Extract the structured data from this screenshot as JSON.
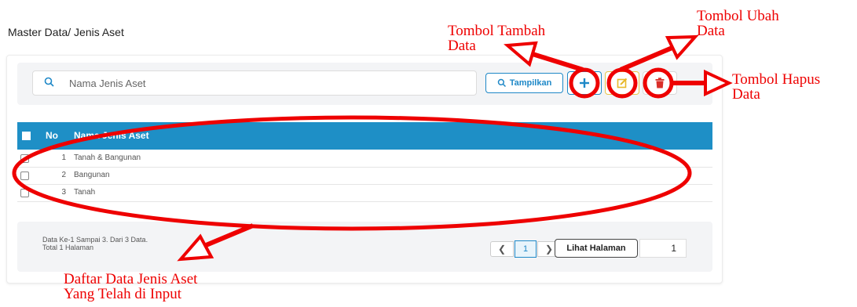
{
  "page": {
    "title": "Master Data/ Jenis Aset"
  },
  "search": {
    "placeholder": "Nama Jenis Aset"
  },
  "toolbar": {
    "tampilkan_label": "Tampilkan",
    "add_icon": "plus-icon",
    "edit_icon": "edit-icon",
    "delete_icon": "trash-icon"
  },
  "table": {
    "columns": [
      "No",
      "Nama Jenis Aset"
    ],
    "rows": [
      {
        "no": "1",
        "name": "Tanah & Bangunan"
      },
      {
        "no": "2",
        "name": "Bangunan"
      },
      {
        "no": "3",
        "name": "Tanah"
      }
    ]
  },
  "footer": {
    "info_line1": "Data Ke-1 Sampai 3. Dari 3 Data.",
    "info_line2": "Total 1 Halaman",
    "current_page": "1",
    "lihat_label": "Lihat Halaman",
    "page_input_value": "1"
  },
  "annotations": {
    "tambah_line1": "Tombol Tambah",
    "tambah_line2": "Data",
    "ubah_line1": "Tombol Ubah",
    "ubah_line2": "Data",
    "hapus_line1": "Tombol Hapus",
    "hapus_line2": "Data",
    "daftar_line1": "Daftar Data Jenis Aset",
    "daftar_line2": "Yang Telah di Input"
  },
  "colors": {
    "primary": "#1e8fc6",
    "annotation": "#ee0000",
    "edit_accent": "#e8c547",
    "delete_accent": "#d9302a"
  }
}
